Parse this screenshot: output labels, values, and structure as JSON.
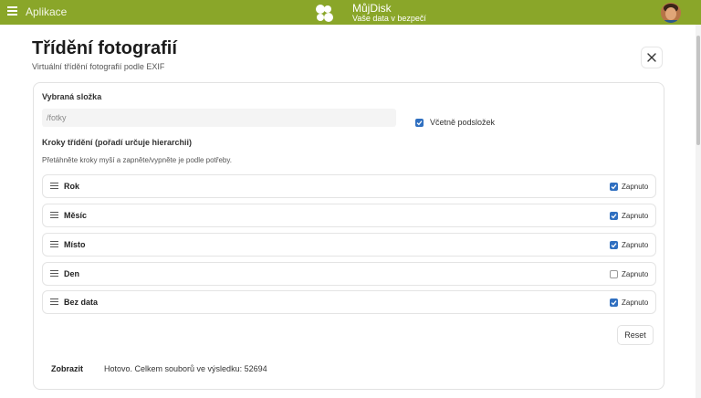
{
  "topbar": {
    "menu_icon": "hamburger-menu-icon",
    "app_label": "Aplikace",
    "brand": "MůjDisk",
    "tagline": "Vaše data v bezpečí",
    "accent_color": "#8aa629"
  },
  "page": {
    "title": "Třídění fotografií",
    "subtitle": "Virtuální třídění fotografií podle EXIF",
    "close_icon": "close-icon"
  },
  "form": {
    "folder_label": "Vybraná složka",
    "folder_placeholder": "/fotky",
    "folder_value": "",
    "include_subfolders_label": "Včetně podsložek",
    "include_subfolders_checked": true,
    "steps_label": "Kroky třídění (pořadí určuje hierarchii)",
    "steps_hint": "Přetáhněte kroky myší a zapněte/vypněte je podle potřeby.",
    "steps": [
      {
        "name": "Rok",
        "toggle_label": "Zapnuto",
        "enabled": true
      },
      {
        "name": "Měsíc",
        "toggle_label": "Zapnuto",
        "enabled": true
      },
      {
        "name": "Místo",
        "toggle_label": "Zapnuto",
        "enabled": true
      },
      {
        "name": "Den",
        "toggle_label": "Zapnuto",
        "enabled": false
      },
      {
        "name": "Bez data",
        "toggle_label": "Zapnuto",
        "enabled": true
      }
    ],
    "reset_label": "Reset",
    "show_label": "Zobrazit",
    "result_text": "Hotovo. Celkem souborů ve výsledku: 52694"
  },
  "colors": {
    "checkbox_checked": "#2f6fc0"
  }
}
